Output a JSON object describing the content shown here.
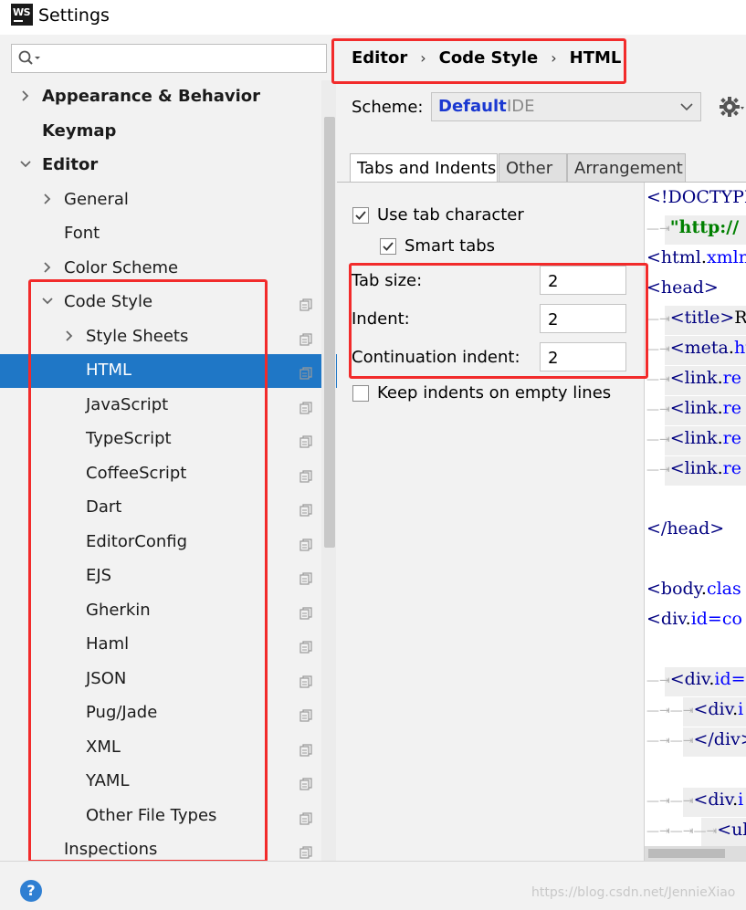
{
  "window": {
    "title": "Settings",
    "logo_text": "WS"
  },
  "search": {
    "value": "",
    "placeholder": ""
  },
  "tree": [
    {
      "label": "Appearance & Behavior",
      "bold": true,
      "chevron": "right",
      "indent": 0,
      "copy": false
    },
    {
      "label": "Keymap",
      "bold": true,
      "chevron": "none",
      "indent": 0,
      "copy": false
    },
    {
      "label": "Editor",
      "bold": true,
      "chevron": "down",
      "indent": 0,
      "copy": false
    },
    {
      "label": "General",
      "bold": false,
      "chevron": "right",
      "indent": 1,
      "copy": false
    },
    {
      "label": "Font",
      "bold": false,
      "chevron": "none",
      "indent": 1,
      "copy": false
    },
    {
      "label": "Color Scheme",
      "bold": false,
      "chevron": "right",
      "indent": 1,
      "copy": false
    },
    {
      "label": "Code Style",
      "bold": false,
      "chevron": "down",
      "indent": 1,
      "copy": true
    },
    {
      "label": "Style Sheets",
      "bold": false,
      "chevron": "right",
      "indent": 2,
      "copy": true
    },
    {
      "label": "HTML",
      "bold": false,
      "chevron": "none",
      "indent": 2,
      "copy": true,
      "selected": true
    },
    {
      "label": "JavaScript",
      "bold": false,
      "chevron": "none",
      "indent": 2,
      "copy": true
    },
    {
      "label": "TypeScript",
      "bold": false,
      "chevron": "none",
      "indent": 2,
      "copy": true
    },
    {
      "label": "CoffeeScript",
      "bold": false,
      "chevron": "none",
      "indent": 2,
      "copy": true
    },
    {
      "label": "Dart",
      "bold": false,
      "chevron": "none",
      "indent": 2,
      "copy": true
    },
    {
      "label": "EditorConfig",
      "bold": false,
      "chevron": "none",
      "indent": 2,
      "copy": true
    },
    {
      "label": "EJS",
      "bold": false,
      "chevron": "none",
      "indent": 2,
      "copy": true
    },
    {
      "label": "Gherkin",
      "bold": false,
      "chevron": "none",
      "indent": 2,
      "copy": true
    },
    {
      "label": "Haml",
      "bold": false,
      "chevron": "none",
      "indent": 2,
      "copy": true
    },
    {
      "label": "JSON",
      "bold": false,
      "chevron": "none",
      "indent": 2,
      "copy": true
    },
    {
      "label": "Pug/Jade",
      "bold": false,
      "chevron": "none",
      "indent": 2,
      "copy": true
    },
    {
      "label": "XML",
      "bold": false,
      "chevron": "none",
      "indent": 2,
      "copy": true
    },
    {
      "label": "YAML",
      "bold": false,
      "chevron": "none",
      "indent": 2,
      "copy": true
    },
    {
      "label": "Other File Types",
      "bold": false,
      "chevron": "none",
      "indent": 2,
      "copy": true
    },
    {
      "label": "Inspections",
      "bold": false,
      "chevron": "none",
      "indent": 1,
      "copy": true
    }
  ],
  "breadcrumb": {
    "part1": "Editor",
    "part2": "Code Style",
    "part3": "HTML",
    "separator": "›"
  },
  "scheme": {
    "label": "Scheme:",
    "value": "Default",
    "sub": "IDE"
  },
  "tabs": {
    "tab1": "Tabs and Indents",
    "tab2": "Other",
    "tab3": "Arrangement",
    "active": "Tabs and Indents"
  },
  "options": {
    "use_tab": {
      "label": "Use tab character",
      "checked": true
    },
    "smart_tabs": {
      "label": "Smart tabs",
      "checked": true
    },
    "tab_size": {
      "label": "Tab size:",
      "value": "2"
    },
    "indent": {
      "label": "Indent:",
      "value": "2"
    },
    "continuation": {
      "label": "Continuation indent:",
      "value": "2"
    },
    "keep_indents": {
      "label": "Keep indents on empty lines",
      "checked": false
    }
  },
  "code_preview": [
    {
      "tabs": "",
      "parts": [
        [
          "tag",
          "<!DOCTYPE"
        ],
        [
          "plain",
          "."
        ]
      ]
    },
    {
      "tabs": "⇥",
      "parts": [
        [
          "str",
          "\"http://"
        ]
      ]
    },
    {
      "tabs": "",
      "parts": [
        [
          "tag",
          "<html"
        ],
        [
          "plain",
          "."
        ],
        [
          "attr",
          "xmln"
        ]
      ]
    },
    {
      "tabs": "",
      "parts": [
        [
          "tag",
          "<head>"
        ]
      ]
    },
    {
      "tabs": "⇥",
      "parts": [
        [
          "tag",
          "<title>"
        ],
        [
          "plain",
          "R"
        ]
      ]
    },
    {
      "tabs": "⇥",
      "parts": [
        [
          "tag",
          "<meta"
        ],
        [
          "plain",
          "."
        ],
        [
          "attr",
          "ht"
        ]
      ]
    },
    {
      "tabs": "⇥",
      "parts": [
        [
          "tag",
          "<link"
        ],
        [
          "plain",
          "."
        ],
        [
          "attr",
          "re"
        ]
      ]
    },
    {
      "tabs": "⇥",
      "parts": [
        [
          "tag",
          "<link"
        ],
        [
          "plain",
          "."
        ],
        [
          "attr",
          "re"
        ]
      ]
    },
    {
      "tabs": "⇥",
      "parts": [
        [
          "tag",
          "<link"
        ],
        [
          "plain",
          "."
        ],
        [
          "attr",
          "re"
        ]
      ]
    },
    {
      "tabs": "⇥",
      "parts": [
        [
          "tag",
          "<link"
        ],
        [
          "plain",
          "."
        ],
        [
          "attr",
          "re"
        ]
      ]
    },
    {
      "tabs": "",
      "parts": []
    },
    {
      "tabs": "",
      "parts": [
        [
          "tag",
          "</head>"
        ]
      ]
    },
    {
      "tabs": "",
      "parts": []
    },
    {
      "tabs": "",
      "parts": [
        [
          "tag",
          "<body"
        ],
        [
          "plain",
          "."
        ],
        [
          "attr",
          "clas"
        ]
      ]
    },
    {
      "tabs": "",
      "parts": [
        [
          "tag",
          "<div"
        ],
        [
          "plain",
          "."
        ],
        [
          "attr",
          "id=co"
        ]
      ]
    },
    {
      "tabs": "",
      "parts": []
    },
    {
      "tabs": "⇥",
      "parts": [
        [
          "tag",
          "<div"
        ],
        [
          "plain",
          "."
        ],
        [
          "attr",
          "id="
        ]
      ]
    },
    {
      "tabs": "⇥⇥",
      "parts": [
        [
          "tag",
          "<div"
        ],
        [
          "plain",
          "."
        ],
        [
          "attr",
          "i"
        ]
      ]
    },
    {
      "tabs": "⇥⇥",
      "parts": [
        [
          "tag",
          "</div>"
        ]
      ]
    },
    {
      "tabs": "",
      "parts": []
    },
    {
      "tabs": "⇥⇥",
      "parts": [
        [
          "tag",
          "<div"
        ],
        [
          "plain",
          "."
        ],
        [
          "attr",
          "i"
        ]
      ]
    },
    {
      "tabs": "⇥⇥⇥",
      "parts": [
        [
          "tag",
          "<ul"
        ],
        [
          "plain",
          "."
        ]
      ]
    }
  ],
  "footer": {
    "help": "?",
    "watermark": "https://blog.csdn.net/JennieXiao"
  },
  "colors": {
    "selection": "#1f77c6",
    "annotation": "#f22b2b",
    "scheme_value": "#1a38d1"
  }
}
